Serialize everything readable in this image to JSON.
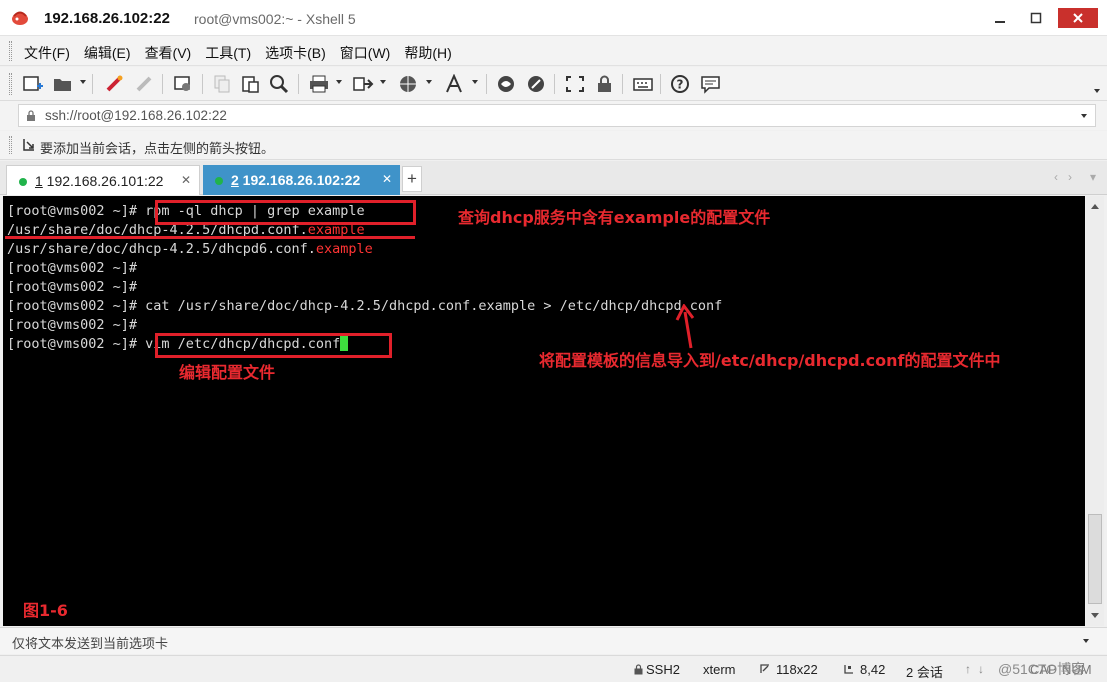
{
  "window": {
    "host_title": "192.168.26.102:22",
    "app_title": "root@vms002:~ - Xshell 5"
  },
  "menu": {
    "items": [
      "文件(F)",
      "编辑(E)",
      "查看(V)",
      "工具(T)",
      "选项卡(B)",
      "窗口(W)",
      "帮助(H)"
    ]
  },
  "address": {
    "url": "ssh://root@192.168.26.102:22"
  },
  "info_bar": {
    "text": "要添加当前会话，点击左侧的箭头按钮。"
  },
  "tabs": [
    {
      "num": "1",
      "label": " 192.168.26.101:22",
      "status_color": "#21b34b",
      "active": false
    },
    {
      "num": "2",
      "label": " 192.168.26.102:22",
      "status_color": "#21b34b",
      "active": true
    }
  ],
  "terminal": {
    "lines": {
      "l1_prompt": "[root@vms002 ~]# ",
      "l1_cmd": "rpm -ql dhcp | grep example",
      "l2_path": "/usr/share/doc/dhcp-4.2.5/dhcpd.conf.",
      "l2_hl": "example",
      "l3_path": "/usr/share/doc/dhcp-4.2.5/dhcpd6.conf.",
      "l3_hl": "example",
      "l4": "[root@vms002 ~]#",
      "l5": "[root@vms002 ~]#",
      "l6_prompt": "[root@vms002 ~]# ",
      "l6_cmd": "cat /usr/share/doc/dhcp-4.2.5/dhcpd.conf.example > /etc/dhcp/dhcpd.conf",
      "l7": "[root@vms002 ~]#",
      "l8_prompt": "[root@vms002 ~]# ",
      "l8_cmd": "vim /etc/dhcp/dhcpd.conf"
    },
    "highlight_color": "#ff3434",
    "cursor_color": "#3edc3e"
  },
  "annotations": {
    "query": "查询dhcp服务中含有example的配置文件",
    "import": "将配置模板的信息导入到/etc/dhcp/dhcpd.conf的配置文件中",
    "edit": "编辑配置文件",
    "figure": "图1-6",
    "color": "#e8292f"
  },
  "send_bar": {
    "placeholder": "仅将文本发送到当前选项卡"
  },
  "status": {
    "protocol": "SSH2",
    "terminal_type": "xterm",
    "size": "118x22",
    "cursor_pos": "8,42",
    "sessions": "2 会话",
    "caps": "CAP",
    "num": "NUM",
    "watermark": "@51CTO博客"
  }
}
